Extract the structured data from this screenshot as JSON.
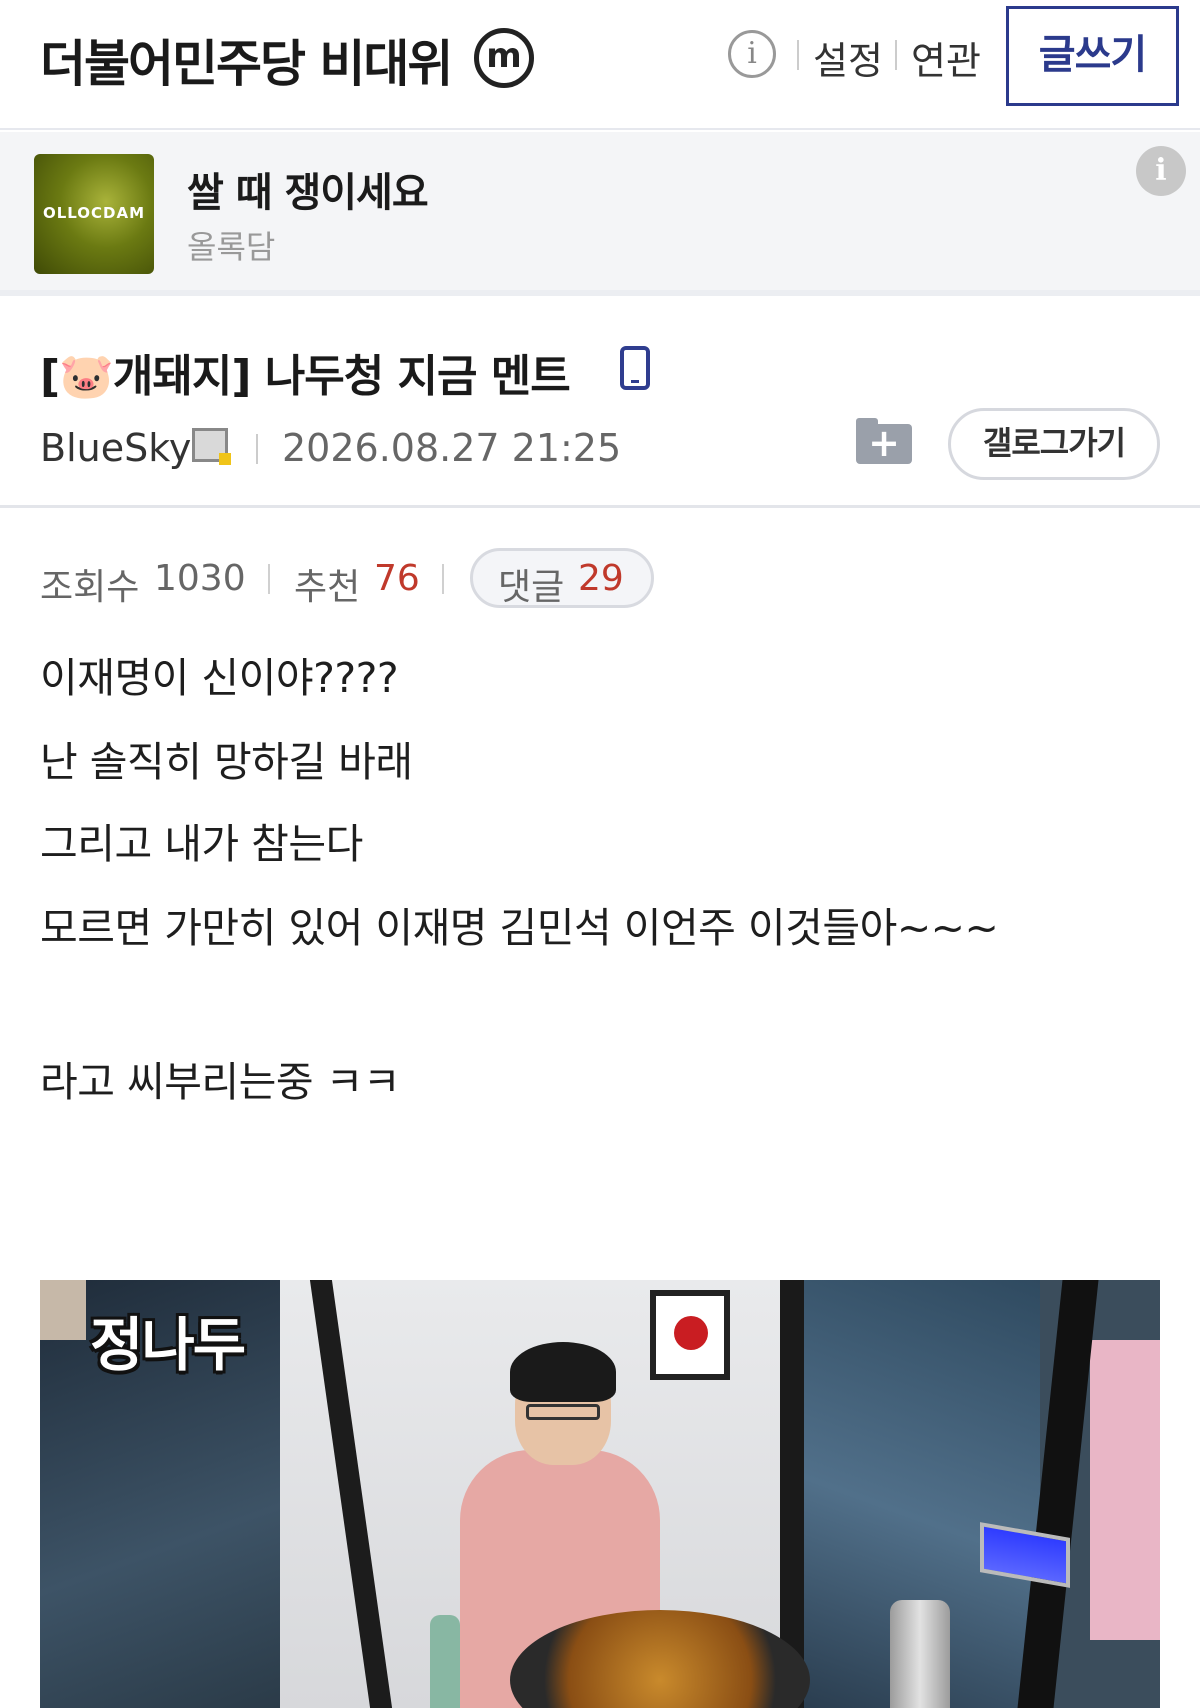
{
  "header": {
    "gallery_title": "더불어민주당 비대위",
    "minor_badge": "m",
    "info_icon": "i",
    "links": [
      "설정",
      "연관"
    ],
    "write_button": "글쓰기"
  },
  "ad": {
    "logo_text": "OLLOCDAM",
    "title": "쌀 때 쟁이세요",
    "subtitle": "올록담",
    "info_icon": "i"
  },
  "post": {
    "title": "[🐷개돼지] 나두청 지금 멘트",
    "author": "BlueSky",
    "date": "2026.08.27 21:25",
    "back_button": "갤로그가기",
    "add_icon": "+"
  },
  "stats": {
    "views_label": "조회수",
    "views": "1030",
    "recommend_label": "추천",
    "recommend": "76",
    "comments_label": "댓글",
    "comments": "29",
    "accent_color": "#c0392b"
  },
  "body": {
    "lines": [
      "이재명이 신이야????",
      "난 솔직히 망하길 바래",
      "그리고 내가 참는다",
      "모르면 가만히 있어 이재명 김민석 이언주 이것들아~~~",
      "라고 씨부리는중 ㅋㅋ"
    ]
  },
  "image": {
    "caption": "정나두"
  }
}
